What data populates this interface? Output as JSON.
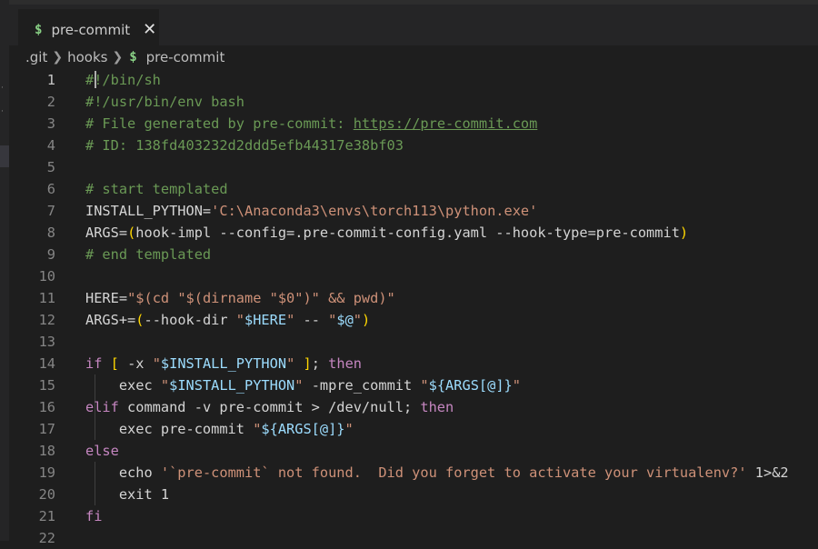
{
  "tab": {
    "icon": "$",
    "label": "pre-commit",
    "close": "✕"
  },
  "breadcrumb": {
    "part1": ".git",
    "part2": "hooks",
    "icon": "$",
    "part3": "pre-commit"
  },
  "lines": [
    {
      "n": "1",
      "t": [
        [
          "c",
          "#!/bin/sh"
        ]
      ]
    },
    {
      "n": "2",
      "t": [
        [
          "c",
          "#!/usr/bin/env bash"
        ]
      ]
    },
    {
      "n": "3",
      "t": [
        [
          "c",
          "# File generated by pre-commit: "
        ],
        [
          "c u",
          "https://pre-commit.com"
        ]
      ]
    },
    {
      "n": "4",
      "t": [
        [
          "c",
          "# ID: 138fd403232d2ddd5efb44317e38bf03"
        ]
      ]
    },
    {
      "n": "5",
      "t": []
    },
    {
      "n": "6",
      "t": [
        [
          "c",
          "# start templated"
        ]
      ]
    },
    {
      "n": "7",
      "t": [
        [
          "",
          "INSTALL_PYTHON="
        ],
        [
          "s",
          "'C:\\Anaconda3\\envs\\torch113\\python.exe'"
        ]
      ]
    },
    {
      "n": "8",
      "t": [
        [
          "",
          "ARGS="
        ],
        [
          "b1",
          "("
        ],
        [
          "",
          "hook-impl --config=.pre-commit-config.yaml --hook-type=pre-commit"
        ],
        [
          "b1",
          ")"
        ]
      ]
    },
    {
      "n": "9",
      "t": [
        [
          "c",
          "# end templated"
        ]
      ]
    },
    {
      "n": "10",
      "t": []
    },
    {
      "n": "11",
      "t": [
        [
          "",
          "HERE="
        ],
        [
          "s",
          "\"$(cd \"$(dirname \"$0\")\" && pwd)\""
        ]
      ]
    },
    {
      "n": "12",
      "t": [
        [
          "",
          "ARGS+="
        ],
        [
          "b1",
          "("
        ],
        [
          "",
          "--hook-dir "
        ],
        [
          "s",
          "\""
        ],
        [
          "v",
          "$HERE"
        ],
        [
          "s",
          "\""
        ],
        [
          "",
          " -- "
        ],
        [
          "s",
          "\""
        ],
        [
          "v",
          "$@"
        ],
        [
          "s",
          "\""
        ],
        [
          "b1",
          ")"
        ]
      ]
    },
    {
      "n": "13",
      "t": []
    },
    {
      "n": "14",
      "t": [
        [
          "k",
          "if"
        ],
        [
          "",
          " "
        ],
        [
          "b1",
          "["
        ],
        [
          "",
          " -x "
        ],
        [
          "s",
          "\""
        ],
        [
          "v",
          "$INSTALL_PYTHON"
        ],
        [
          "s",
          "\""
        ],
        [
          "",
          " "
        ],
        [
          "b1",
          "]"
        ],
        [
          "",
          "; "
        ],
        [
          "k",
          "then"
        ]
      ]
    },
    {
      "n": "15",
      "t": [
        [
          "",
          "    exec "
        ],
        [
          "s",
          "\""
        ],
        [
          "v",
          "$INSTALL_PYTHON"
        ],
        [
          "s",
          "\""
        ],
        [
          "",
          " -mpre_commit "
        ],
        [
          "s",
          "\""
        ],
        [
          "v",
          "${ARGS[@]}"
        ],
        [
          "s",
          "\""
        ]
      ]
    },
    {
      "n": "16",
      "t": [
        [
          "k",
          "elif"
        ],
        [
          "",
          " command -v pre-commit > /dev/null; "
        ],
        [
          "k",
          "then"
        ]
      ]
    },
    {
      "n": "17",
      "t": [
        [
          "",
          "    exec pre-commit "
        ],
        [
          "s",
          "\""
        ],
        [
          "v",
          "${ARGS[@]}"
        ],
        [
          "s",
          "\""
        ]
      ]
    },
    {
      "n": "18",
      "t": [
        [
          "k",
          "else"
        ]
      ]
    },
    {
      "n": "19",
      "t": [
        [
          "",
          "    echo "
        ],
        [
          "s",
          "'`pre-commit` not found.  Did you forget to activate your virtualenv?'"
        ],
        [
          "",
          " 1>&2"
        ]
      ]
    },
    {
      "n": "20",
      "t": [
        [
          "",
          "    exit 1"
        ]
      ]
    },
    {
      "n": "21",
      "t": [
        [
          "k",
          "fi"
        ]
      ]
    },
    {
      "n": "22",
      "t": []
    }
  ]
}
